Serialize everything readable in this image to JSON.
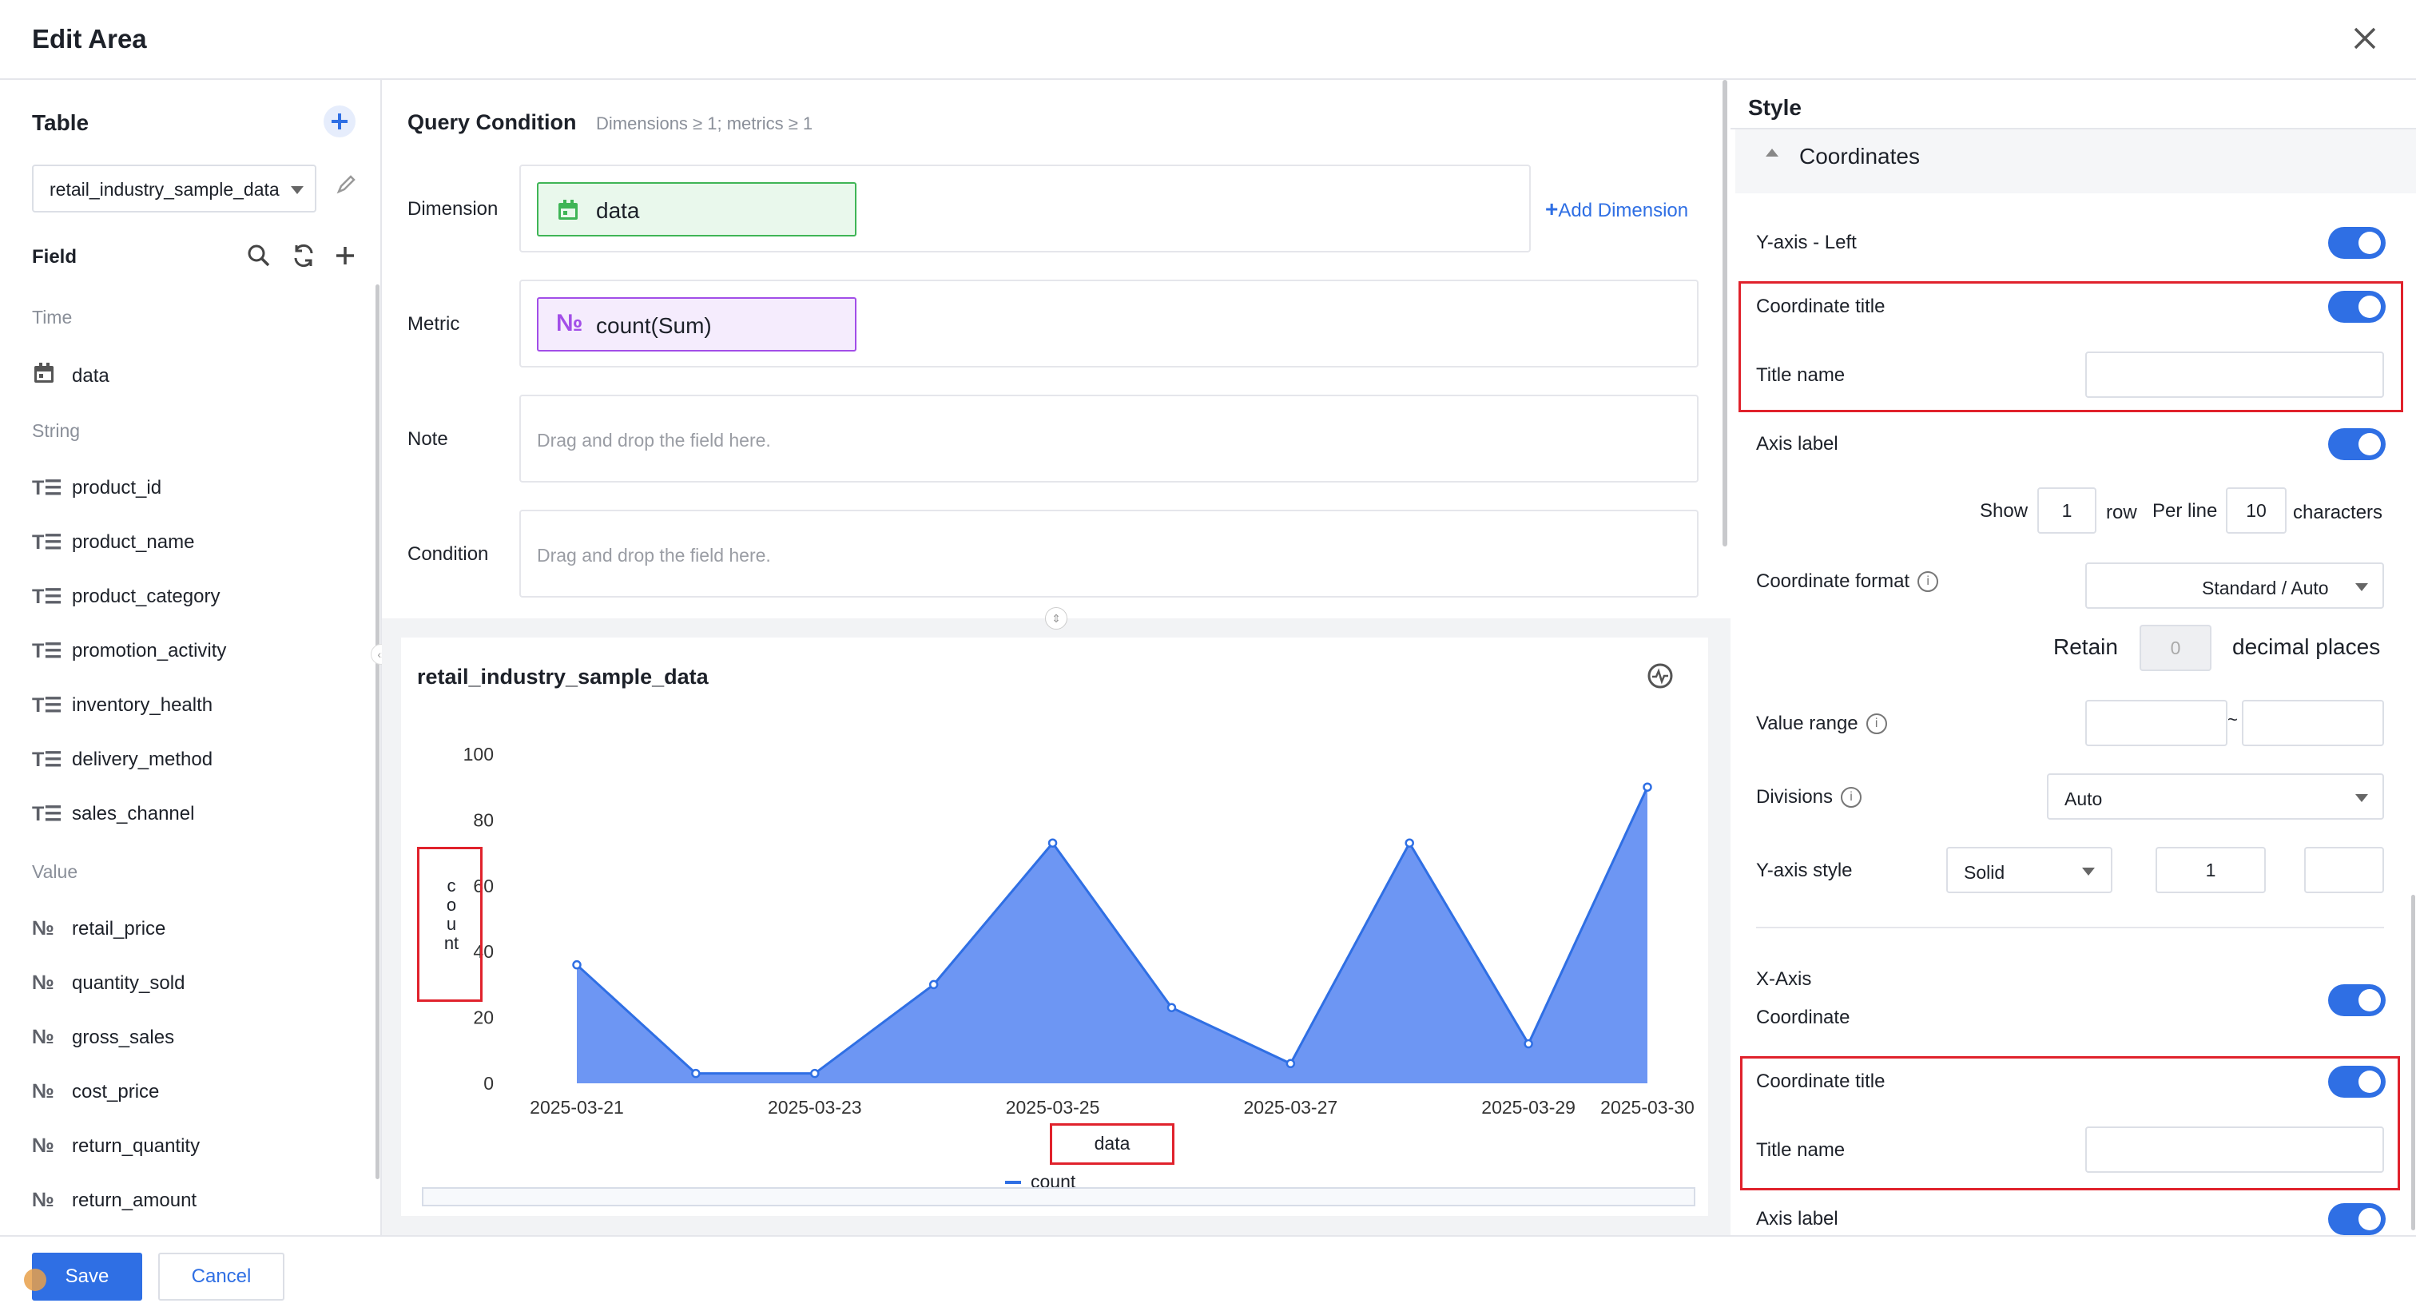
{
  "dialog": {
    "title": "Edit Area"
  },
  "left": {
    "table_title": "Table",
    "table_select": "retail_industry_sample_data",
    "field_title": "Field",
    "groups": {
      "time": "Time",
      "string": "String",
      "value": "Value"
    },
    "time_fields": [
      "data"
    ],
    "string_fields": [
      "product_id",
      "product_name",
      "product_category",
      "promotion_activity",
      "inventory_health",
      "delivery_method",
      "sales_channel"
    ],
    "value_fields": [
      "retail_price",
      "quantity_sold",
      "gross_sales",
      "cost_price",
      "return_quantity",
      "return_amount"
    ]
  },
  "query": {
    "title": "Query Condition",
    "hint": "Dimensions ≥ 1; metrics ≥ 1",
    "dimension_label": "Dimension",
    "dimension_value": "data",
    "add_dimension": "Add Dimension",
    "metric_label": "Metric",
    "metric_value": "count(Sum)",
    "note_label": "Note",
    "condition_label": "Condition",
    "drop_placeholder": "Drag and drop the field here."
  },
  "chart_data": {
    "type": "area",
    "title": "retail_industry_sample_data",
    "x": [
      "2025-03-21",
      "2025-03-22",
      "2025-03-23",
      "2025-03-24",
      "2025-03-25",
      "2025-03-26",
      "2025-03-27",
      "2025-03-28",
      "2025-03-29",
      "2025-03-30"
    ],
    "x_tick_labels": [
      "2025-03-21",
      "2025-03-23",
      "2025-03-25",
      "2025-03-27",
      "2025-03-29",
      "2025-03-30"
    ],
    "series": [
      {
        "name": "count",
        "values": [
          36,
          3,
          3,
          30,
          73,
          23,
          6,
          73,
          12,
          90
        ]
      }
    ],
    "xlabel": "data",
    "ylabel": "count",
    "ylim": [
      0,
      100
    ],
    "yticks": [
      0,
      20,
      40,
      60,
      80,
      100
    ],
    "legend": "bottom",
    "color": "#2f6fe4",
    "fill": "#6d96f3"
  },
  "style": {
    "tab": "Style",
    "section": "Coordinates",
    "yaxis_left": "Y-axis - Left",
    "coord_title": "Coordinate title",
    "title_name": "Title name",
    "axis_label": "Axis label",
    "show": "Show",
    "show_rows": "1",
    "row": "row",
    "per_line": "Per line",
    "chars": "10",
    "characters": "characters",
    "coord_format": "Coordinate format",
    "coord_format_value": "Standard / Auto",
    "retain": "Retain",
    "decimals": "0",
    "decimal_places": "decimal places",
    "value_range": "Value range",
    "range_sep": "~",
    "divisions": "Divisions",
    "divisions_value": "Auto",
    "yaxis_style": "Y-axis style",
    "line_style": "Solid",
    "line_width": "1",
    "xaxis": "X-Axis",
    "xaxis_coord": "Coordinate",
    "coord_title2": "Coordinate title",
    "title_name2": "Title name",
    "axis_label2": "Axis label"
  },
  "footer": {
    "save": "Save",
    "cancel": "Cancel"
  },
  "colors": {
    "primary": "#2f6fe4",
    "highlight": "#e0222c",
    "dim_bg": "#e9f8ec",
    "dim_border": "#3fb556",
    "metric_bg": "#f5ecfd",
    "metric_border": "#a24ee8"
  }
}
